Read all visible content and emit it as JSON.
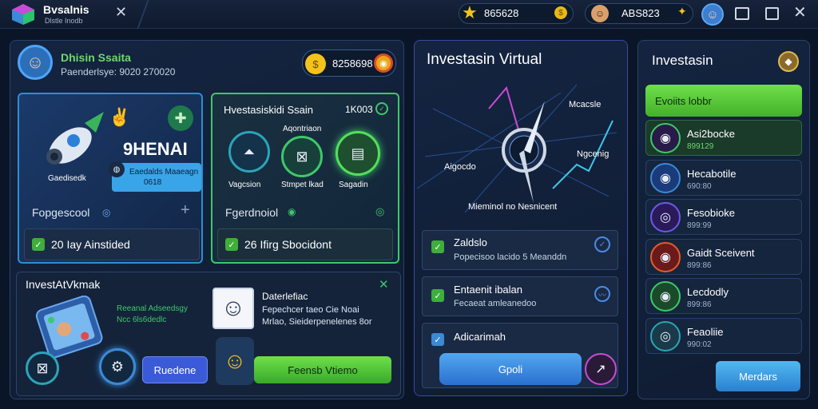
{
  "app": {
    "title": "Bvsalnis",
    "subtitle": "Dlstle Inodb"
  },
  "topbar": {
    "coins": "865628",
    "user": "ABS823"
  },
  "profile": {
    "name": "Dhisin Ssaita",
    "meta": "Paenderlsye: 9020 270020",
    "currency": "8258698"
  },
  "card_left": {
    "title": "9HENAI",
    "badge_line1": "Eaedalds Maaeagn",
    "badge_line2": "0618",
    "caption": "Gaedisedk",
    "footer": "Fopgescool",
    "task": "20 Iay Ainstided"
  },
  "card_mid": {
    "title": "Hvestasiskidi Ssain",
    "value": "1K003",
    "subtitle": "Aqontriaon",
    "items": [
      "Vagcsion",
      "Stmpet lkad",
      "Sagadin"
    ],
    "footer": "Fgerdnoiol",
    "task": "26 Ifirg Sbocidont"
  },
  "invest_box": {
    "title": "InvestAtVkmak",
    "promo_line1": "Reeanal Adseedsgy",
    "promo_line2": "Ncc 6ls6dedlc",
    "person_line1": "Daterlefiac",
    "person_line2": "Fepechcer taeo Cie Noai",
    "person_line3": "Mrlao, Sieiderpenelenes 8or",
    "button_secondary": "Ruedene",
    "button_primary": "Feensb Vtiemo"
  },
  "virtual": {
    "title": "Investasin Virtual",
    "label_tr": "Mcacsle",
    "label_left": "Aigocdo",
    "label_right": "Ngcenig",
    "caption": "Mieminol no Nesnicent",
    "tasks": [
      {
        "title": "Zaldslo",
        "sub": "Popecisoo lacido 5 Meanddn"
      },
      {
        "title": "Entaenit ibalan",
        "sub": "Fecaeat amleanedoo"
      },
      {
        "title": "Adicarimah",
        "sub": ""
      }
    ],
    "button": "Gpoli"
  },
  "sidebar": {
    "title": "Investasin",
    "header": "Evoiits lobbr",
    "items": [
      {
        "name": "Asi2bocke",
        "value": "899129"
      },
      {
        "name": "Hecabotile",
        "value": "690:80"
      },
      {
        "name": "Fesobioke",
        "value": "899:99"
      },
      {
        "name": "Gaidt Sceivent",
        "value": "899:86"
      },
      {
        "name": "Lecdodly",
        "value": "899:86"
      },
      {
        "name": "Feaoliie",
        "value": "990:02"
      }
    ],
    "button": "Merdars"
  }
}
